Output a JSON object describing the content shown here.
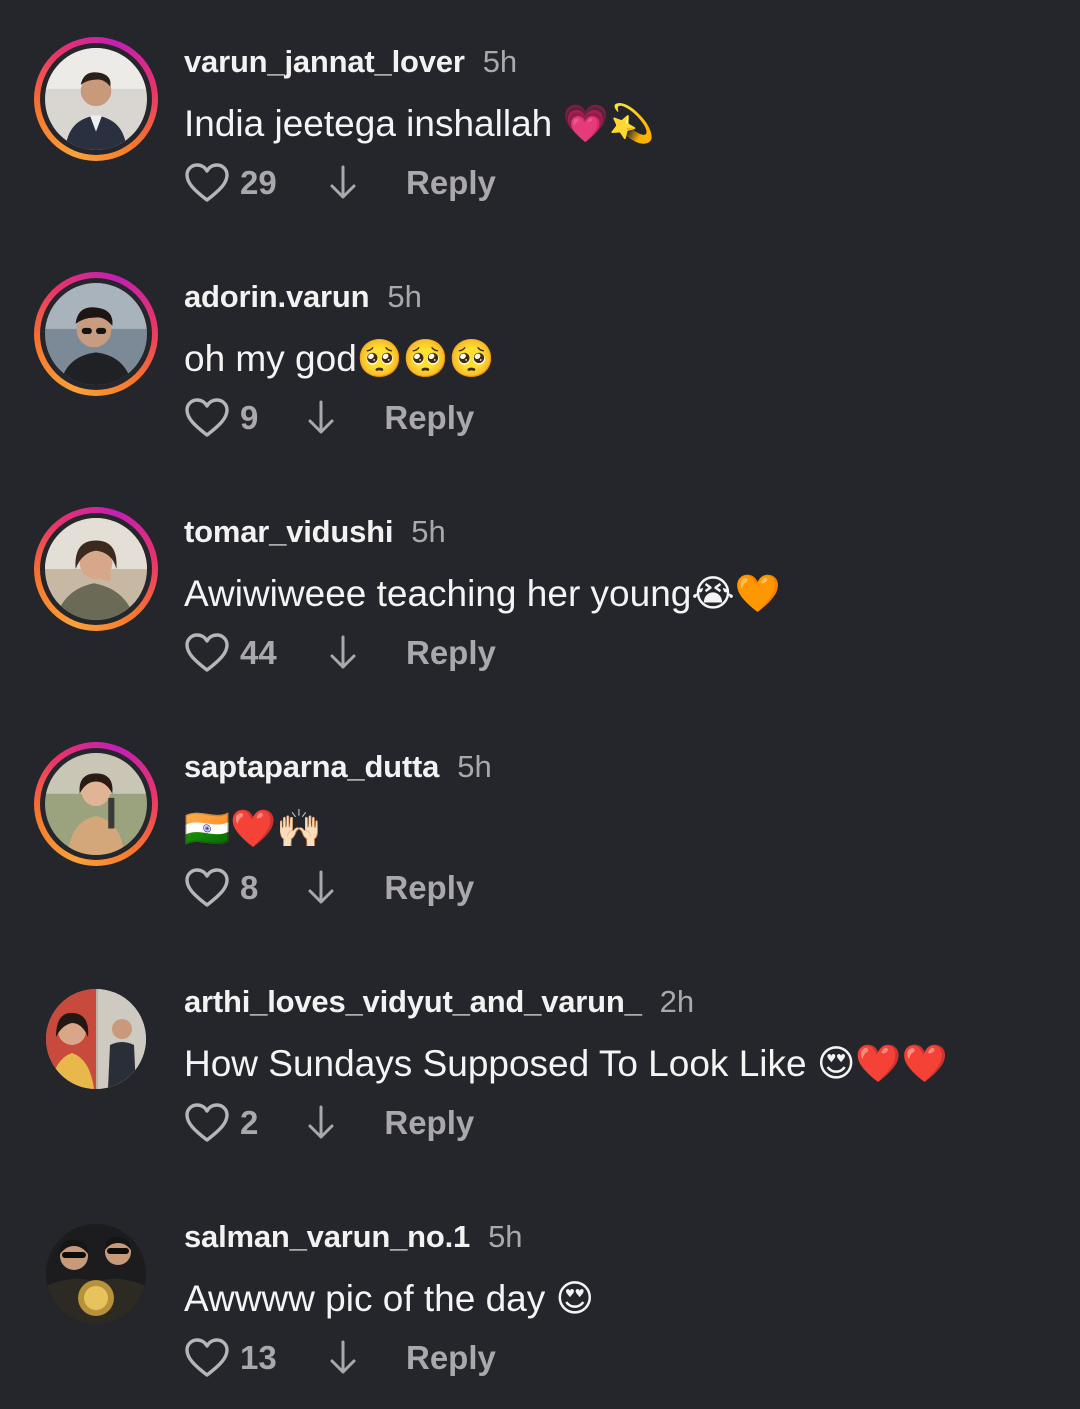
{
  "comments": [
    {
      "username": "varun_jannat_lover",
      "time": "5h",
      "text": "India jeetega inshallah 💗💫",
      "likes": "29",
      "reply_label": "Reply",
      "has_story_ring": true
    },
    {
      "username": "adorin.varun",
      "time": "5h",
      "text": "oh my god🥺🥺🥺",
      "likes": "9",
      "reply_label": "Reply",
      "has_story_ring": true
    },
    {
      "username": "tomar_vidushi",
      "time": "5h",
      "text": "Awiwiweee teaching her young😭🧡",
      "likes": "44",
      "reply_label": "Reply",
      "has_story_ring": true
    },
    {
      "username": "saptaparna_dutta",
      "time": "5h",
      "text": "🇮🇳❤️🙌🏻",
      "likes": "8",
      "reply_label": "Reply",
      "has_story_ring": true
    },
    {
      "username": "arthi_loves_vidyut_and_varun_",
      "time": "2h",
      "text": "How Sundays Supposed To Look Like 😍❤️❤️",
      "likes": "2",
      "reply_label": "Reply",
      "has_story_ring": false
    },
    {
      "username": "salman_varun_no.1",
      "time": "5h",
      "text": "Awwww pic of the day 😍",
      "likes": "13",
      "reply_label": "Reply",
      "has_story_ring": false
    }
  ],
  "icons": {
    "like": "heart-outline-icon",
    "dislike": "arrow-down-icon"
  },
  "colors": {
    "background": "#25262b",
    "text": "#f2f2f2",
    "secondary": "#a8a8ad",
    "ring_start": "#f9a13a",
    "ring_end": "#c21fb5"
  }
}
